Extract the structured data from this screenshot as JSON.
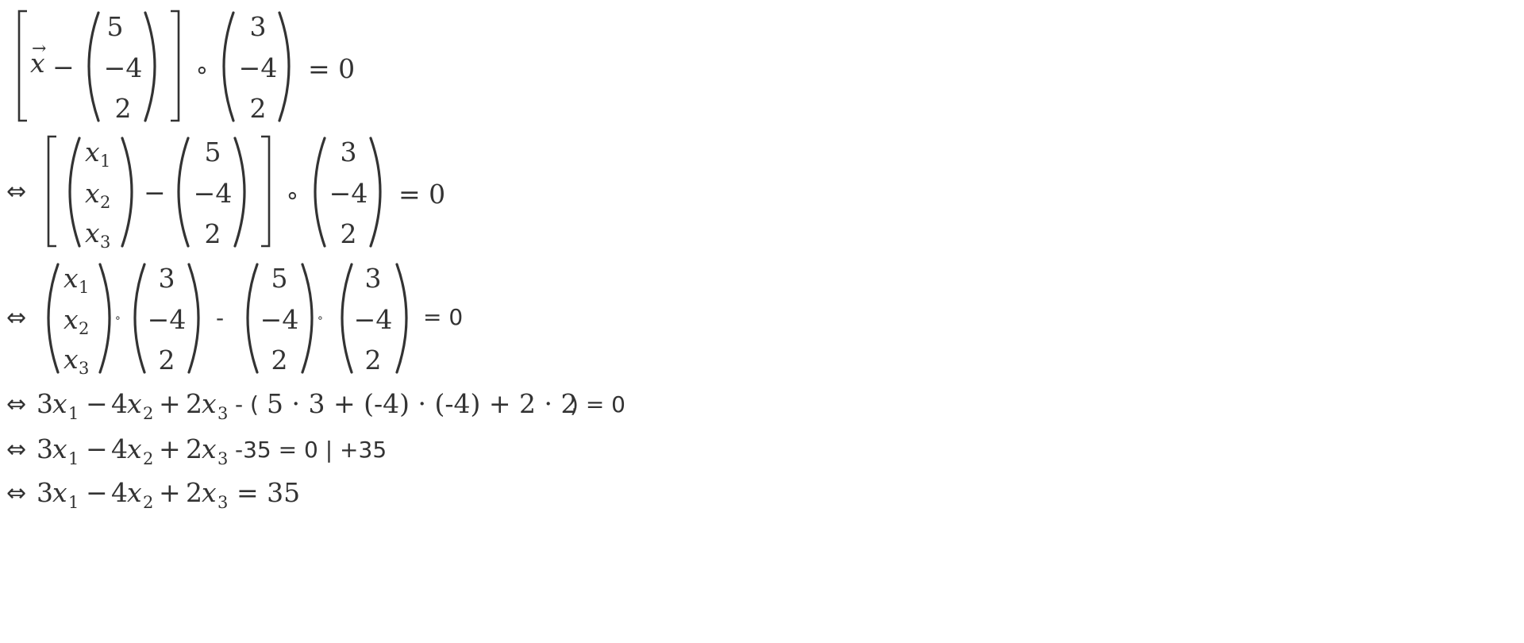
{
  "document": {
    "symbols": {
      "iff": "⇔",
      "minus": "−",
      "circ": "∘",
      "equals": "=",
      "dot": "∘",
      "arrow": "→"
    },
    "vectors": {
      "p": [
        "5",
        "−4",
        "2"
      ],
      "n": [
        "3",
        "−4",
        "2"
      ],
      "x": [
        "x",
        "x",
        "x"
      ],
      "x_subs": [
        "1",
        "2",
        "3"
      ],
      "x_plain": "x"
    },
    "line1": {
      "rhs": "= 0"
    },
    "line2": {
      "rhs": "= 0"
    },
    "line3": {
      "minus": "-",
      "rhs": "= 0"
    },
    "line4": {
      "prefix": "⇔",
      "terms": [
        {
          "coef": "3",
          "var": "x",
          "sub": "1"
        },
        {
          "op": "−",
          "coef": "4",
          "var": "x",
          "sub": "2"
        },
        {
          "op": "+",
          "coef": "2",
          "var": "x",
          "sub": "3"
        }
      ],
      "middle": "- (",
      "inner": "5 · 3 + (-4) · (-4) + 2 · 2",
      "tail": ") = 0"
    },
    "line5": {
      "prefix": "⇔",
      "terms": [
        {
          "coef": "3",
          "var": "x",
          "sub": "1"
        },
        {
          "op": "−",
          "coef": "4",
          "var": "x",
          "sub": "2"
        },
        {
          "op": "+",
          "coef": "2",
          "var": "x",
          "sub": "3"
        }
      ],
      "tail": "-35 = 0 | +35"
    },
    "line6": {
      "prefix": "⇔",
      "terms": [
        {
          "coef": "3",
          "var": "x",
          "sub": "1"
        },
        {
          "op": "−",
          "coef": "4",
          "var": "x",
          "sub": "2"
        },
        {
          "op": "+",
          "coef": "2",
          "var": "x",
          "sub": "3"
        }
      ],
      "tail": "= 35"
    }
  }
}
